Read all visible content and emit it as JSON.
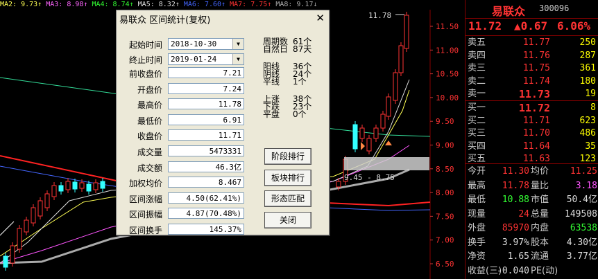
{
  "ma_bar": [
    {
      "label": "MA2: 9.73↑",
      "color": "#ffff55"
    },
    {
      "label": "MA3: 8.98↑",
      "color": "#ff66ff"
    },
    {
      "label": "MA4: 8.74↑",
      "color": "#33ff33"
    },
    {
      "label": "MA5: 8.32↑",
      "color": "#dddddd"
    },
    {
      "label": "MA6: 7.60↑",
      "color": "#4466ff"
    },
    {
      "label": "MA7: 7.75↑",
      "color": "#ff3333"
    },
    {
      "label": "MA8: 9.17↓",
      "color": "#aaaaaa"
    }
  ],
  "chart": {
    "high_label": "11.78",
    "range_label": "9.45 - 8.75",
    "y_ticks": [
      "11.50",
      "11.00",
      "10.50",
      "10.00",
      "9.50",
      "9.00",
      "8.50",
      "8.00",
      "7.50",
      "7.00",
      "6.50"
    ]
  },
  "dialog": {
    "title": "易联众 区间统计(复权)",
    "fields": [
      {
        "label": "起始时间",
        "value": "2018-10-30",
        "dropdown": true
      },
      {
        "label": "终止时间",
        "value": "2019-01-24",
        "dropdown": true
      },
      {
        "label": "前收盘价",
        "value": "7.21"
      },
      {
        "label": "开盘价",
        "value": "7.24"
      },
      {
        "label": "最高价",
        "value": "11.78"
      },
      {
        "label": "最低价",
        "value": "6.91"
      },
      {
        "label": "收盘价",
        "value": "11.71"
      },
      {
        "label": "成交量",
        "value": "5473331"
      },
      {
        "label": "成交额",
        "value": "46.3亿"
      },
      {
        "label": "加权均价",
        "value": "8.467"
      },
      {
        "label": "区间涨幅",
        "value": "4.50(62.41%)"
      },
      {
        "label": "区间振幅",
        "value": "4.87(70.48%)"
      },
      {
        "label": "区间换手",
        "value": "145.37%"
      }
    ],
    "right_stats": [
      {
        "label": "周期数",
        "value": "61个"
      },
      {
        "label": "自然日",
        "value": "87天"
      },
      {
        "label": "阳线",
        "value": "36个"
      },
      {
        "label": "阴线",
        "value": "24个"
      },
      {
        "label": "平线",
        "value": "1个"
      },
      {
        "label": "上涨",
        "value": "38个"
      },
      {
        "label": "下跌",
        "value": "23个"
      },
      {
        "label": "平盘",
        "value": "0个"
      }
    ],
    "buttons": [
      "阶段排行",
      "板块排行",
      "形态匹配",
      "关闭"
    ],
    "close_glyph": "✕"
  },
  "quote": {
    "name": "易联众",
    "code": "300096",
    "price": "11.72",
    "change": "▲0.67",
    "pct": "6.06%",
    "sells": [
      {
        "label": "卖五",
        "price": "11.77",
        "vol": "250"
      },
      {
        "label": "卖四",
        "price": "11.76",
        "vol": "287"
      },
      {
        "label": "卖三",
        "price": "11.75",
        "vol": "361"
      },
      {
        "label": "卖二",
        "price": "11.74",
        "vol": "180"
      },
      {
        "label": "卖一",
        "price": "11.73",
        "vol": "19"
      }
    ],
    "buys": [
      {
        "label": "买一",
        "price": "11.72",
        "vol": "8"
      },
      {
        "label": "买二",
        "price": "11.71",
        "vol": "623"
      },
      {
        "label": "买三",
        "price": "11.70",
        "vol": "486"
      },
      {
        "label": "买四",
        "price": "11.64",
        "vol": "35"
      },
      {
        "label": "买五",
        "price": "11.63",
        "vol": "123"
      }
    ],
    "stats": [
      {
        "l1": "今开",
        "v1": "11.30",
        "c1": "#ff3333",
        "l2": "均价",
        "v2": "11.25",
        "c2": "#ff3333"
      },
      {
        "l1": "最高",
        "v1": "11.78",
        "c1": "#ff3333",
        "l2": "量比",
        "v2": "3.18",
        "c2": "#ff55ff"
      },
      {
        "l1": "最低",
        "v1": "10.88",
        "c1": "#33ff33",
        "l2": "市值",
        "v2": "50.4亿",
        "c2": "#dddddd"
      },
      {
        "l1": "现量",
        "v1": "24",
        "c1": "#ff3333",
        "l2": "总量",
        "v2": "149508",
        "c2": "#dddddd"
      },
      {
        "l1": "外盘",
        "v1": "85970",
        "c1": "#ff3333",
        "l2": "内盘",
        "v2": "63538",
        "c2": "#33ff33"
      },
      {
        "l1": "换手",
        "v1": "3.97%",
        "c1": "#dddddd",
        "l2": "股本",
        "v2": "4.30亿",
        "c2": "#dddddd"
      },
      {
        "l1": "净资",
        "v1": "1.65",
        "c1": "#dddddd",
        "l2": "流通",
        "v2": "3.77亿",
        "c2": "#dddddd"
      },
      {
        "l1": "收益(三)",
        "v1": "-0.040",
        "c1": "#dddddd",
        "l2": "PE(动)",
        "v2": "",
        "c2": "#dddddd"
      }
    ]
  }
}
